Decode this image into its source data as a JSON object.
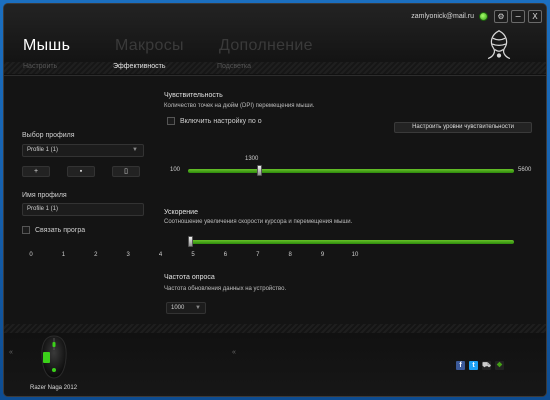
{
  "titlebar": {
    "email": "zamlyonick@mail.ru",
    "btn_settings": "⚙",
    "btn_minimize": "−",
    "btn_close": "X"
  },
  "main_tabs": [
    "Мышь",
    "Макросы",
    "Дополнение"
  ],
  "sub_tabs": [
    "Настроить",
    "Эффективность",
    "Подсветка"
  ],
  "left_panel": {
    "profile_label": "Выбор профиля",
    "profile_value": "Profile 1 (1)",
    "btn_add": "+",
    "btn_edit": "▪",
    "btn_delete": "▯",
    "name_label": "Имя профиля",
    "name_value": "Profile 1 (1)",
    "link_label": "Связать програ"
  },
  "sensitivity": {
    "title": "Чувствительность",
    "desc": "Количество точек на дюйм (DPI) перемещения мыши.",
    "enable_label": "Включить настройку по о",
    "configure_button": "Настроить уровни чувствительности",
    "min_label": "100",
    "max_label": "5600",
    "value_label": "1300",
    "value": 1300,
    "min": 100,
    "max": 5600
  },
  "acceleration": {
    "title": "Ускорение",
    "desc": "Соотношение увеличения скорости курсора и перемещения мыши.",
    "value": 0,
    "ticks": [
      "0",
      "1",
      "2",
      "3",
      "4",
      "5",
      "6",
      "7",
      "8",
      "9",
      "10"
    ]
  },
  "polling": {
    "title": "Частота опроса",
    "desc": "Частота обновления данных на устройство.",
    "value": "1000"
  },
  "footer": {
    "device_name": "Razer Naga 2012",
    "left_arrow": "«",
    "right_arrow": "«"
  },
  "colors": {
    "accent": "#45a317",
    "desktop": "#1a64b2",
    "window_bg": "#141414"
  }
}
